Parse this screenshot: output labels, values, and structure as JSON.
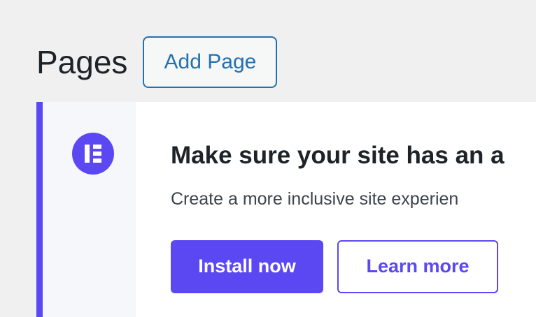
{
  "header": {
    "title": "Pages",
    "add_button_label": "Add Page"
  },
  "notice": {
    "icon": "elementor-logo-icon",
    "heading": "Make sure your site has an a",
    "description": "Create a more inclusive site experien",
    "actions": {
      "primary_label": "Install now",
      "secondary_label": "Learn more"
    }
  },
  "colors": {
    "background": "#f0f0f1",
    "accent": "#5b48f2",
    "wordpress_blue": "#2271b1",
    "notice_background": "#ffffff",
    "icon_column_background": "#f6f7fb"
  }
}
